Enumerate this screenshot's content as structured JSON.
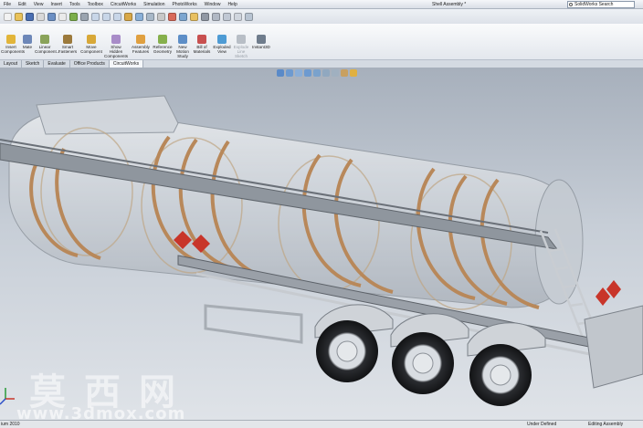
{
  "app": {
    "menu": [
      "File",
      "Edit",
      "View",
      "Insert",
      "Tools",
      "Toolbox",
      "CircuitWorks",
      "Simulation",
      "PhotoWorks",
      "Window",
      "Help"
    ],
    "doc_title": "Shell Assembly *",
    "search_placeholder": "SolidWorks Search"
  },
  "command_manager": {
    "items": [
      {
        "label": "Insert Components",
        "color": "#e2b53a",
        "enabled": true
      },
      {
        "label": "Mate",
        "color": "#6d87b8",
        "enabled": true
      },
      {
        "label": "Linear Component...",
        "color": "#8aa35a",
        "enabled": true
      },
      {
        "label": "Smart Fasteners",
        "color": "#9c7a3c",
        "enabled": true
      },
      {
        "label": "Move Component",
        "color": "#d8a838",
        "enabled": true
      },
      {
        "label": "Show Hidden Components",
        "color": "#a88cc8",
        "enabled": true
      },
      {
        "label": "Assembly Features",
        "color": "#e0a040",
        "enabled": true
      },
      {
        "label": "Reference Geometry",
        "color": "#86b04c",
        "enabled": true
      },
      {
        "label": "New Motion Study",
        "color": "#5d8ec7",
        "enabled": true
      },
      {
        "label": "Bill of Materials",
        "color": "#c85050",
        "enabled": true
      },
      {
        "label": "Exploded View",
        "color": "#4e9bd4",
        "enabled": true
      },
      {
        "label": "Explode Line Sketch",
        "color": "#b8bec6",
        "enabled": false
      },
      {
        "label": "Instant3D",
        "color": "#6f7c8c",
        "enabled": true
      }
    ]
  },
  "tabs": [
    {
      "label": "Layout",
      "active": false
    },
    {
      "label": "Sketch",
      "active": false
    },
    {
      "label": "Evaluate",
      "active": false
    },
    {
      "label": "Office Products",
      "active": false
    },
    {
      "label": "CircuitWorks",
      "active": true
    }
  ],
  "status": {
    "left": "ium 2010",
    "center": "Under Defined",
    "right": "Editing Assembly"
  },
  "watermark": {
    "cn": "莫西网",
    "url": "www.3dmox.com"
  },
  "colors": {
    "tank_glass": "#d8dde2",
    "frame": "#b8885a",
    "hazard": "#c8352a",
    "chrome": "#c7cbd0"
  }
}
